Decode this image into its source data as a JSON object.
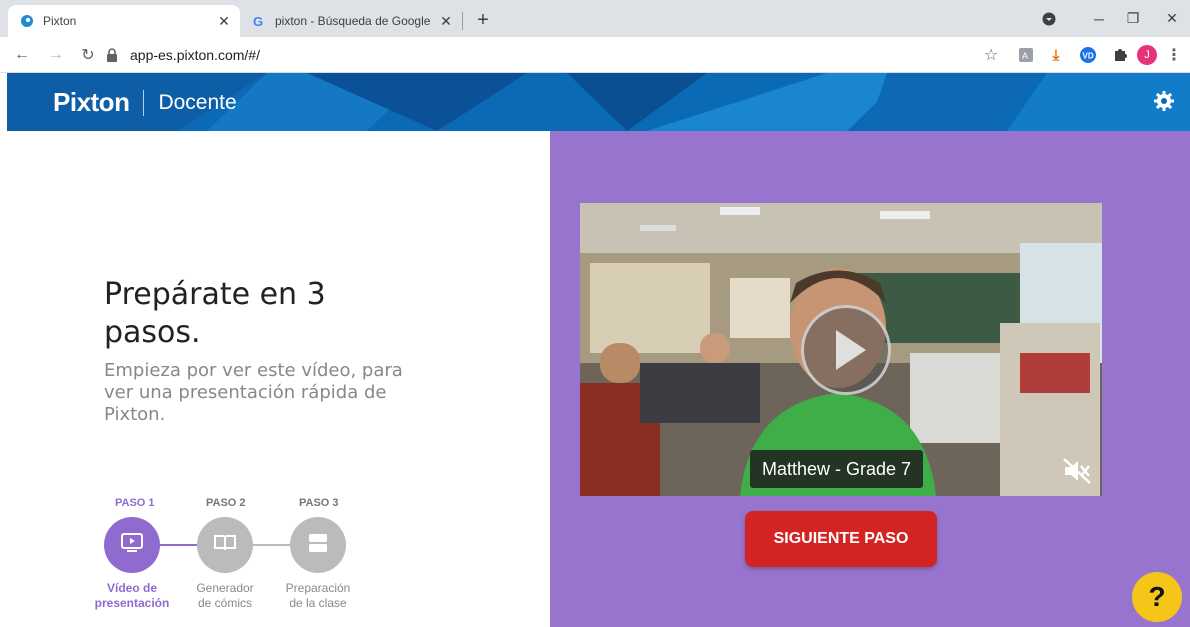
{
  "browser": {
    "tabs": [
      {
        "title": "Pixton",
        "active": true
      },
      {
        "title": "pixton - Búsqueda de Google",
        "active": false
      }
    ],
    "url": "app-es.pixton.com/#/",
    "profile_initial": "J"
  },
  "header": {
    "brand": "Pixton",
    "role": "Docente"
  },
  "intro": {
    "heading": "Prepárate en 3 pasos.",
    "subheading": "Empieza por ver este vídeo, para ver una presentación rápida de Pixton."
  },
  "steps": [
    {
      "label": "PASO 1",
      "description_line1": "Vídeo de",
      "description_line2": "presentación",
      "icon": "video-icon",
      "active": true
    },
    {
      "label": "PASO 2",
      "description_line1": "Generador",
      "description_line2": "de cómics",
      "icon": "book-icon",
      "active": false
    },
    {
      "label": "PASO 3",
      "description_line1": "Preparación",
      "description_line2": "de la clase",
      "icon": "layout-icon",
      "active": false
    }
  ],
  "video": {
    "caption": "Matthew - Grade 7",
    "muted": true
  },
  "next_button": "SIGUIENTE PASO",
  "help_button": "?",
  "colors": {
    "header_blue": "#0a6ab6",
    "panel_purple": "#9775ce",
    "step_active": "#8f6bcf",
    "step_inactive": "#bbbbbb",
    "button_red": "#d42323",
    "help_yellow": "#f5c518"
  }
}
